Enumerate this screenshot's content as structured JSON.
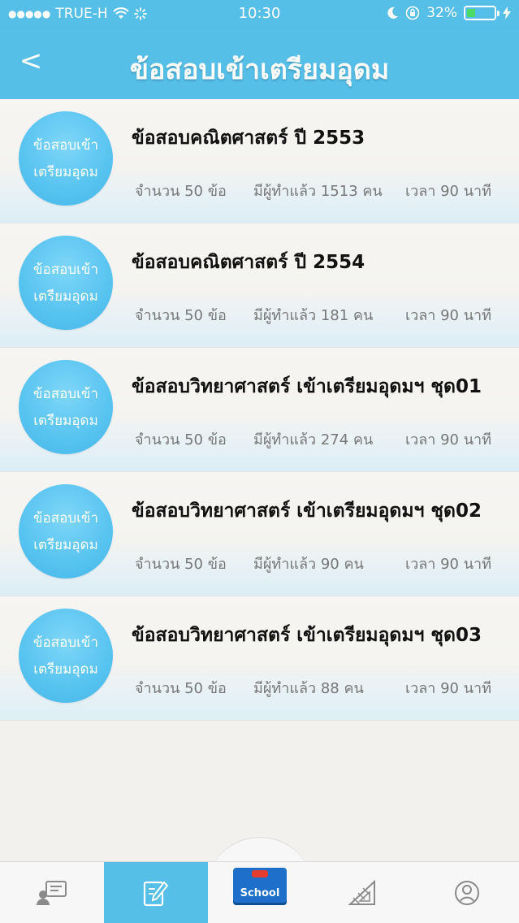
{
  "status_bar": {
    "carrier": "TRUE-H",
    "time": "10:30",
    "battery": "32%",
    "battery_level": 0.32
  },
  "header": {
    "back_label": "<",
    "title": "ข้อสอบเข้าเตรียมอุดม"
  },
  "exams": [
    {
      "badge_line1": "ข้อสอบเข้า",
      "badge_line2": "เตรียมอุดม",
      "title": "ข้อสอบคณิตศาสตร์ ปี 2553",
      "questions": "จำนวน 50 ข้อ",
      "done": "มีผู้ทำแล้ว 1513 คน",
      "time": "เวลา 90 นาที"
    },
    {
      "badge_line1": "ข้อสอบเข้า",
      "badge_line2": "เตรียมอุดม",
      "title": "ข้อสอบคณิตศาสตร์ ปี 2554",
      "questions": "จำนวน 50 ข้อ",
      "done": "มีผู้ทำแล้ว 181 คน",
      "time": "เวลา 90 นาที"
    },
    {
      "badge_line1": "ข้อสอบเข้า",
      "badge_line2": "เตรียมอุดม",
      "title": "ข้อสอบวิทยาศาสตร์ เข้าเตรียมอุดมฯ ชุด01",
      "questions": "จำนวน 50 ข้อ",
      "done": "มีผู้ทำแล้ว 274 คน",
      "time": "เวลา 90 นาที"
    },
    {
      "badge_line1": "ข้อสอบเข้า",
      "badge_line2": "เตรียมอุดม",
      "title": "ข้อสอบวิทยาศาสตร์ เข้าเตรียมอุดมฯ ชุด02",
      "questions": "จำนวน 50 ข้อ",
      "done": "มีผู้ทำแล้ว 90 คน",
      "time": "เวลา 90 นาที"
    },
    {
      "badge_line1": "ข้อสอบเข้า",
      "badge_line2": "เตรียมอุดม",
      "title": "ข้อสอบวิทยาศาสตร์ เข้าเตรียมอุดมฯ ชุด03",
      "questions": "จำนวน 50 ข้อ",
      "done": "มีผู้ทำแล้ว 88 คน",
      "time": "เวลา 90 นาที"
    }
  ],
  "tab_bar": {
    "tabs": [
      "chat-board-icon",
      "edit-note-icon",
      "school-logo",
      "ruler-triangle-icon",
      "profile-icon"
    ],
    "active_index": 1,
    "school_label": "School"
  },
  "colors": {
    "accent": "#55bfe8",
    "badge": "#57c3f0",
    "battery_fill": "#4cd964"
  }
}
